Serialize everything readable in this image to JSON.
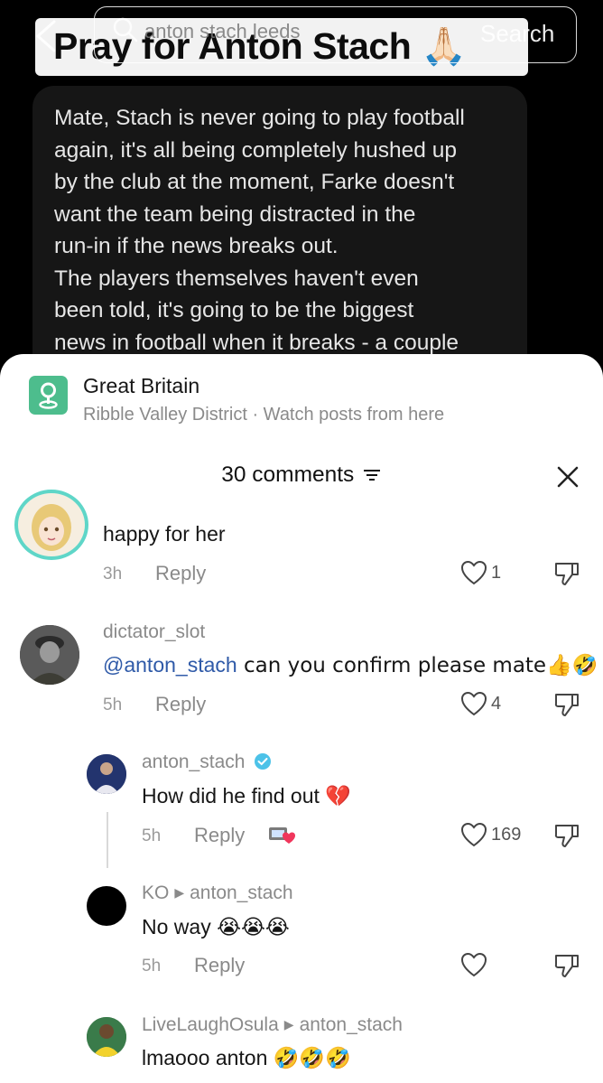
{
  "post": {
    "title": "Pray for Anton Stach 🙏🏻",
    "lines": [
      "Mate, Stach is never going to play football",
      "again, it's all being completely hushed up",
      "by the club at the moment, Farke doesn't",
      "want the team being distracted in the",
      "run-in if the news breaks out.",
      "The players themselves haven't even",
      "been told, it's going to be the biggest",
      "news in football when it breaks - a couple"
    ]
  },
  "search": {
    "value": "anton stach leeds",
    "button_label": "Search"
  },
  "location": {
    "title": "Great Britain",
    "subtitle": "Ribble Valley District · Watch posts from here"
  },
  "comments_header": {
    "count_label": "30 comments"
  },
  "comments": [
    {
      "text": "happy for her",
      "time": "3h",
      "reply_label": "Reply",
      "likes": "1"
    },
    {
      "user": "dictator_slot",
      "mention": "@anton_stach",
      "text": " can you confirm please mate👍🤣",
      "time": "5h",
      "reply_label": "Reply",
      "likes": "4"
    }
  ],
  "replies": [
    {
      "user": "anton_stach",
      "text": "How did he find out 💔",
      "time": "5h",
      "reply_label": "Reply",
      "likes": "169"
    },
    {
      "user": "KO",
      "reply_to": "anton_stach",
      "text": "No way 😭😭😭",
      "time": "5h",
      "reply_label": "Reply"
    },
    {
      "user": "LiveLaughOsula",
      "reply_to": "anton_stach",
      "text": "lmaooo anton 🤣🤣🤣"
    }
  ],
  "colors": {
    "accent_location": "#4dbd8d",
    "mention": "#2f5aa8",
    "avatar_ring": "#5fd6c8"
  }
}
